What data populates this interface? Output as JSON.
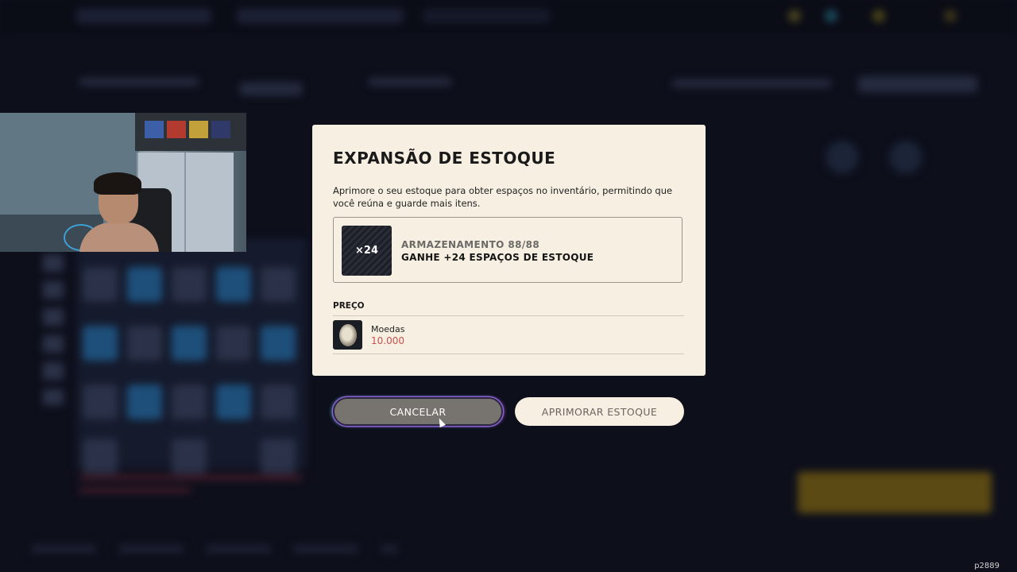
{
  "modal": {
    "title": "EXPANSÃO DE ESTOQUE",
    "description": "Aprimore o seu estoque para obter espaços no inventário, permitindo que você reúna e guarde mais itens.",
    "offer": {
      "tile_label": "×24",
      "storage_label": "ARMAZENAMENTO",
      "storage_value": "88/88",
      "gain_text": "GANHE +24 ESPAÇOS DE ESTOQUE"
    },
    "price_label": "PREÇO",
    "currency": {
      "name": "Moedas",
      "amount": "10.000",
      "icon": "coin-icon"
    }
  },
  "buttons": {
    "cancel_label": "CANCELAR",
    "upgrade_label": "APRIMORAR ESTOQUE"
  },
  "stream_id": "p2889",
  "colors": {
    "modal_bg": "#f6efe2",
    "price_red": "#c9504c",
    "cancel_bg": "#77746f"
  }
}
